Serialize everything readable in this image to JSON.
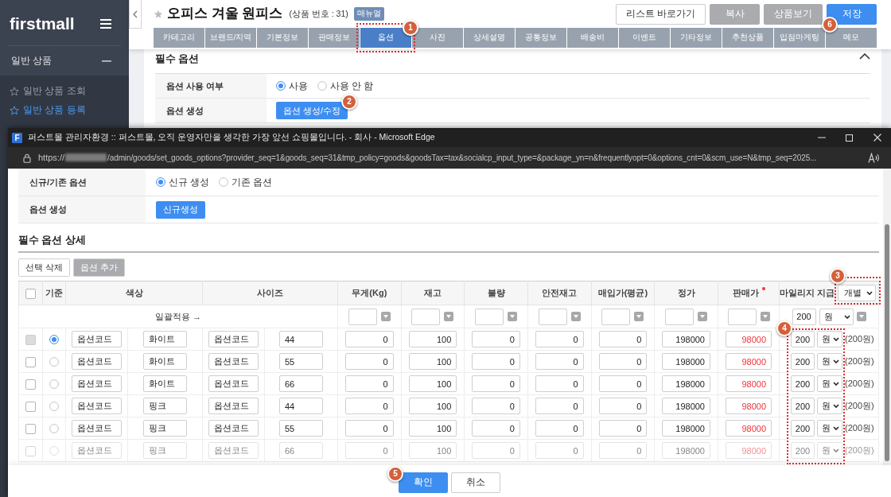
{
  "sidebar": {
    "logo": "firstmall",
    "section": {
      "title": "일반 상품",
      "expanded": true
    },
    "items": [
      {
        "label": "일반 상품 조회",
        "selected": false
      },
      {
        "label": "일반 상품 등록",
        "selected": true
      }
    ]
  },
  "product": {
    "title": "오피스 겨울 원피스",
    "number": "(상품 번호 : 31)",
    "badge": "매뉴얼",
    "starred": false
  },
  "header_buttons": [
    {
      "label": "리스트 바로가기",
      "kind": "outline"
    },
    {
      "label": "복사",
      "kind": "gray"
    },
    {
      "label": "상품보기",
      "kind": "gray"
    },
    {
      "label": "저장",
      "kind": "primary",
      "callout": {
        "number": "6"
      }
    }
  ],
  "tabs": [
    {
      "label": "카테고리",
      "selected": false
    },
    {
      "label": "브랜드/지역",
      "selected": false
    },
    {
      "label": "기본정보",
      "selected": false
    },
    {
      "label": "판매정보",
      "selected": false
    },
    {
      "label": "옵션",
      "selected": true,
      "callout": {
        "number": "1",
        "outlined": true
      }
    },
    {
      "label": "사진",
      "selected": false
    },
    {
      "label": "상세설명",
      "selected": false
    },
    {
      "label": "공통정보",
      "selected": false
    },
    {
      "label": "배송비",
      "selected": false
    },
    {
      "label": "이벤트",
      "selected": false
    },
    {
      "label": "기타정보",
      "selected": false
    },
    {
      "label": "추천상품",
      "selected": false
    },
    {
      "label": "입점마케팅",
      "selected": false
    },
    {
      "label": "메모",
      "selected": false
    }
  ],
  "required_option": {
    "title": "필수 옵션",
    "expanded": true,
    "rows": [
      {
        "label": "옵션 사용 여부",
        "kind": "radio",
        "options": [
          {
            "label": "사용",
            "selected": true
          },
          {
            "label": "사용 안 함",
            "selected": false
          }
        ]
      },
      {
        "label": "옵션 생성",
        "kind": "button",
        "button": "옵션 생성/수정",
        "callout": {
          "number": "2"
        }
      }
    ]
  },
  "popup": {
    "icon_letter": "F",
    "title": "퍼스트몰 관리자환경 :: 퍼스트몰, 오직 운영자만을 생각한 가장 앞선 쇼핑몰입니다. - 회사 - Microsoft Edge",
    "url_start": "https://",
    "url_rest": "/admin/goods/set_goods_options?provider_seq=1&goods_seq=31&tmp_policy=goods&goodsTax=tax&socialcp_input_type=&package_yn=n&frequentlyopt=0&options_cnt=0&scm_use=N&tmp_seq=2025...",
    "settings": [
      {
        "label": "신규/기존 옵션",
        "kind": "radio",
        "options": [
          {
            "label": "신규 생성",
            "selected": true
          },
          {
            "label": "기존 옵션",
            "selected": false
          }
        ]
      },
      {
        "label": "옵션 생성",
        "kind": "button",
        "button": "신규생성"
      }
    ],
    "detail": {
      "title": "필수 옵션 상세",
      "actions": [
        {
          "label": "선택 삭제",
          "kind": "outline"
        },
        {
          "label": "옵션 추가",
          "kind": "gray"
        }
      ],
      "columns": [
        {
          "kind": "check",
          "checked": false
        },
        {
          "kind": "radio",
          "label": "기준"
        },
        {
          "kind": "pair",
          "label": "색상"
        },
        {
          "kind": "pair",
          "label": "사이즈"
        },
        {
          "kind": "number",
          "label": "무게(Kg)"
        },
        {
          "kind": "number",
          "label": "재고"
        },
        {
          "kind": "number",
          "label": "불량"
        },
        {
          "kind": "number",
          "label": "안전재고"
        },
        {
          "kind": "number",
          "label": "매입가(평균)"
        },
        {
          "kind": "number",
          "label": "정가"
        },
        {
          "kind": "sale",
          "label": "판매가",
          "required": true
        },
        {
          "kind": "mileage",
          "label": "마일리지 지급",
          "select": {
            "value": "개별",
            "callout": {
              "number": "3",
              "outlined": true
            }
          },
          "callout": {
            "number": "4",
            "outlined": true
          }
        }
      ],
      "batch": {
        "label": "일괄적용 →",
        "mileage": "200",
        "unit": "원"
      },
      "rows": [
        {
          "checked": false,
          "disabled": true,
          "selected": true,
          "cells": [
            "",
            "",
            [
              "옵션코드",
              "화이트"
            ],
            [
              "옵션코드",
              "44"
            ],
            "0",
            "100",
            "0",
            "0",
            "0",
            "198000",
            "98000",
            [
              "200",
              "원",
              "(200원)"
            ]
          ]
        },
        {
          "checked": false,
          "disabled": false,
          "selected": false,
          "cells": [
            "",
            "",
            [
              "옵션코드",
              "화이트"
            ],
            [
              "옵션코드",
              "55"
            ],
            "0",
            "100",
            "0",
            "0",
            "0",
            "198000",
            "98000",
            [
              "200",
              "원",
              "(200원)"
            ]
          ]
        },
        {
          "checked": false,
          "disabled": false,
          "selected": false,
          "cells": [
            "",
            "",
            [
              "옵션코드",
              "화이트"
            ],
            [
              "옵션코드",
              "66"
            ],
            "0",
            "100",
            "0",
            "0",
            "0",
            "198000",
            "98000",
            [
              "200",
              "원",
              "(200원)"
            ]
          ]
        },
        {
          "checked": false,
          "disabled": false,
          "selected": false,
          "cells": [
            "",
            "",
            [
              "옵션코드",
              "핑크"
            ],
            [
              "옵션코드",
              "44"
            ],
            "0",
            "100",
            "0",
            "0",
            "0",
            "198000",
            "98000",
            [
              "200",
              "원",
              "(200원)"
            ]
          ]
        },
        {
          "checked": false,
          "disabled": false,
          "selected": false,
          "cells": [
            "",
            "",
            [
              "옵션코드",
              "핑크"
            ],
            [
              "옵션코드",
              "55"
            ],
            "0",
            "100",
            "0",
            "0",
            "0",
            "198000",
            "98000",
            [
              "200",
              "원",
              "(200원)"
            ]
          ]
        },
        {
          "checked": false,
          "disabled": false,
          "selected": false,
          "cells": [
            "",
            "",
            [
              "옵션코드",
              "핑크"
            ],
            [
              "옵션코드",
              "66"
            ],
            "0",
            "100",
            "0",
            "0",
            "0",
            "198000",
            "98000",
            [
              "200",
              "원",
              "(200원)"
            ]
          ]
        }
      ]
    },
    "footer_buttons": [
      {
        "label": "확인",
        "kind": "primary",
        "callout": {
          "number": "5"
        }
      },
      {
        "label": "취소",
        "kind": "outline"
      }
    ]
  }
}
